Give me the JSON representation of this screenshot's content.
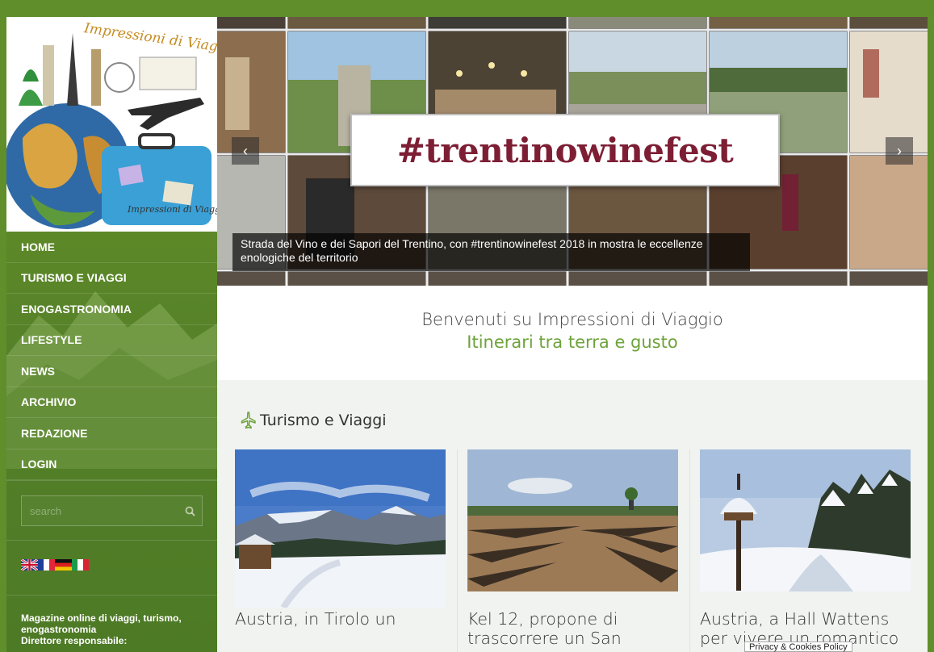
{
  "sidebar": {
    "logo_text": "Impressioni di Viaggio",
    "logo_caption": "Impressioni di Viaggio",
    "nav": [
      {
        "label": "HOME"
      },
      {
        "label": "TURISMO E VIAGGI"
      },
      {
        "label": "ENOGASTRONOMIA"
      },
      {
        "label": "LIFESTYLE"
      },
      {
        "label": "NEWS"
      },
      {
        "label": "ARCHIVIO"
      },
      {
        "label": "REDAZIONE"
      },
      {
        "label": "LOGIN"
      }
    ],
    "search_placeholder": "search",
    "languages": [
      "english-flag",
      "french-flag",
      "german-flag",
      "italian-flag"
    ],
    "description_line1": "Magazine online di viaggi, turismo,",
    "description_line2": "enogastronomia",
    "description_line3": "Direttore responsabile:"
  },
  "hero": {
    "banner_text": "#trentinowinefest",
    "caption": "Strada del Vino e dei Sapori del Trentino, con #trentinowinefest 2018 in mostra le eccellenze enologiche del territorio",
    "prev_icon": "chevron-left-icon",
    "next_icon": "chevron-right-icon"
  },
  "welcome": {
    "line1": "Benvenuti su Impressioni di Viaggio",
    "line2": "Itinerari tra terra e gusto"
  },
  "section": {
    "title": "Turismo e Viaggi",
    "icon": "airplane-icon",
    "cards": [
      {
        "title": "Austria, in Tirolo un"
      },
      {
        "title": "Kel 12, propone di trascorrere un San"
      },
      {
        "title": "Austria, a Hall Wattens per vivere un romantico"
      }
    ]
  },
  "privacy_label": "Privacy & Cookies Policy",
  "colors": {
    "frame_green": "#5f8e2b",
    "accent_green": "#6da33a",
    "banner_text": "#7d1e34"
  }
}
